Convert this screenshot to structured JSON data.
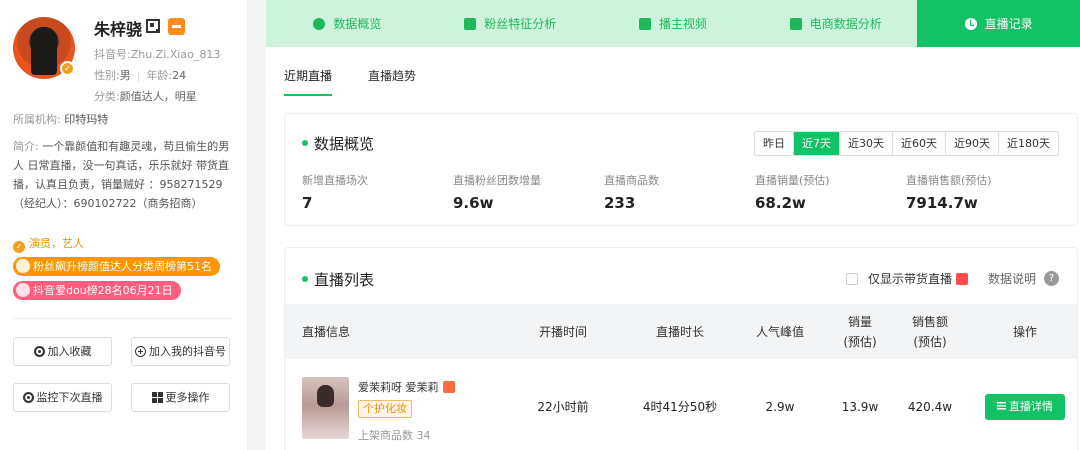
{
  "profile": {
    "name": "朱梓骁",
    "douyin_id": "抖音号:Zhu.Zi.Xiao_813",
    "gender_label": "性别:",
    "gender": "男",
    "age_label": "年龄:",
    "age": "24",
    "category_label": "分类:",
    "category": "颜值达人，明星",
    "org_label": "所属机构: ",
    "org": "印特玛特",
    "bio_label": "简介: ",
    "bio": "一个靠颜值和有趣灵魂，苟且偷生的男人 日常直播，没一句真话，乐乐就好 带货直播，认真且负责，销量贼好 ：958271529（经纪人）：690102722（商务招商）",
    "verified_tag": "演员，艺人",
    "rank_1": "粉丝飙升榜颜值达人分类周榜第51名",
    "rank_2": "抖音爱dou榜28名06月21日",
    "accent_color": "#13c265"
  },
  "sidebar_actions": {
    "favorite": "加入收藏",
    "add_to_my": "加入我的抖音号",
    "monitor": "监控下次直播",
    "more": "更多操作"
  },
  "topnav": {
    "tabs": [
      {
        "label": "数据概览",
        "icon": "pie-chart-icon"
      },
      {
        "label": "粉丝特征分析",
        "icon": "id-card-icon"
      },
      {
        "label": "播主视频",
        "icon": "video-icon"
      },
      {
        "label": "电商数据分析",
        "icon": "shop-bag-icon"
      },
      {
        "label": "直播记录",
        "icon": "clock-icon"
      }
    ],
    "active_index": 4
  },
  "subtabs": [
    "近期直播",
    "直播趋势"
  ],
  "overview": {
    "title": "数据概览",
    "ranges": [
      "昨日",
      "近7天",
      "近30天",
      "近60天",
      "近90天",
      "近180天"
    ],
    "active_range": "近7天",
    "stats": [
      {
        "label": "新增直播场次",
        "value": "7"
      },
      {
        "label": "直播粉丝团数增量",
        "value": "9.6w"
      },
      {
        "label": "直播商品数",
        "value": "233"
      },
      {
        "label": "直播销量(预估)",
        "value": "68.2w"
      },
      {
        "label": "直播销售额(预估)",
        "value": "7914.7w"
      }
    ]
  },
  "live_list": {
    "title": "直播列表",
    "only_goods_label": "仅显示带货直播",
    "data_note": "数据说明",
    "columns": [
      "直播信息",
      "开播时间",
      "直播时长",
      "人气峰值",
      "销量\n(预估)",
      "销售额\n(预估)",
      "操作"
    ],
    "columns_split": {
      "info": "直播信息",
      "start": "开播时间",
      "duration": "直播时长",
      "peak": "人气峰值",
      "sales_1": "销量",
      "sales_2": "(预估)",
      "revenue_1": "销售额",
      "revenue_2": "(预估)",
      "action": "操作"
    },
    "rows": [
      {
        "title": "爱茉莉呀 爱茉莉",
        "category": "个护化妆",
        "goods_count": "上架商品数 34",
        "start": "22小时前",
        "duration": "4时41分50秒",
        "peak": "2.9w",
        "sales": "13.9w",
        "revenue": "420.4w",
        "action": "直播详情"
      }
    ]
  }
}
